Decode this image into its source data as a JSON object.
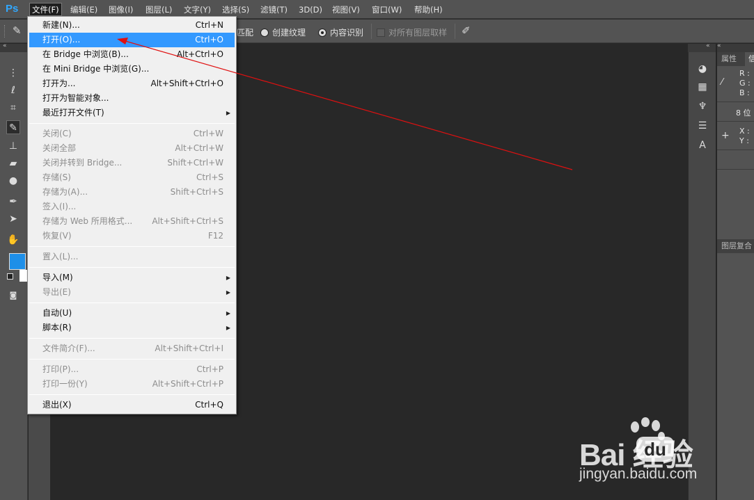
{
  "app": {
    "logo": "Ps"
  },
  "menubar": {
    "items": [
      "文件(F)",
      "编辑(E)",
      "图像(I)",
      "图层(L)",
      "文字(Y)",
      "选择(S)",
      "滤镜(T)",
      "3D(D)",
      "视图(V)",
      "窗口(W)",
      "帮助(H)"
    ]
  },
  "options_bar": {
    "partial_label": "匹配",
    "radio_create_texture": "创建纹理",
    "radio_content_aware": "内容识别",
    "checkbox_sample_all": "对所有图层取样"
  },
  "right_panel": {
    "tab_properties": "属性",
    "tab_info_partial": "信",
    "r_label": "R :",
    "g_label": "G :",
    "b_label": "B :",
    "bit_label": "8 位",
    "x_label": "X :",
    "y_label": "Y :",
    "lower_tab": "图层复合"
  },
  "file_menu": {
    "groups": [
      [
        {
          "label": "新建(N)...",
          "shortcut": "Ctrl+N",
          "enabled": true
        },
        {
          "label": "打开(O)...",
          "shortcut": "Ctrl+O",
          "enabled": true,
          "highlighted": true
        },
        {
          "label": "在 Bridge 中浏览(B)...",
          "shortcut": "Alt+Ctrl+O",
          "enabled": true
        },
        {
          "label": "在 Mini Bridge 中浏览(G)...",
          "shortcut": "",
          "enabled": true
        },
        {
          "label": "打开为...",
          "shortcut": "Alt+Shift+Ctrl+O",
          "enabled": true
        },
        {
          "label": "打开为智能对象...",
          "shortcut": "",
          "enabled": true
        },
        {
          "label": "最近打开文件(T)",
          "shortcut": "",
          "enabled": true,
          "submenu": true
        }
      ],
      [
        {
          "label": "关闭(C)",
          "shortcut": "Ctrl+W",
          "enabled": false
        },
        {
          "label": "关闭全部",
          "shortcut": "Alt+Ctrl+W",
          "enabled": false
        },
        {
          "label": "关闭并转到 Bridge...",
          "shortcut": "Shift+Ctrl+W",
          "enabled": false
        },
        {
          "label": "存储(S)",
          "shortcut": "Ctrl+S",
          "enabled": false
        },
        {
          "label": "存储为(A)...",
          "shortcut": "Shift+Ctrl+S",
          "enabled": false
        },
        {
          "label": "签入(I)...",
          "shortcut": "",
          "enabled": false
        },
        {
          "label": "存储为 Web 所用格式...",
          "shortcut": "Alt+Shift+Ctrl+S",
          "enabled": false
        },
        {
          "label": "恢复(V)",
          "shortcut": "F12",
          "enabled": false
        }
      ],
      [
        {
          "label": "置入(L)...",
          "shortcut": "",
          "enabled": false
        }
      ],
      [
        {
          "label": "导入(M)",
          "shortcut": "",
          "enabled": true,
          "submenu": true
        },
        {
          "label": "导出(E)",
          "shortcut": "",
          "enabled": false,
          "submenu": true
        }
      ],
      [
        {
          "label": "自动(U)",
          "shortcut": "",
          "enabled": true,
          "submenu": true
        },
        {
          "label": "脚本(R)",
          "shortcut": "",
          "enabled": true,
          "submenu": true
        }
      ],
      [
        {
          "label": "文件简介(F)...",
          "shortcut": "Alt+Shift+Ctrl+I",
          "enabled": false
        }
      ],
      [
        {
          "label": "打印(P)...",
          "shortcut": "Ctrl+P",
          "enabled": false
        },
        {
          "label": "打印一份(Y)",
          "shortcut": "Alt+Shift+Ctrl+P",
          "enabled": false
        }
      ],
      [
        {
          "label": "退出(X)",
          "shortcut": "Ctrl+Q",
          "enabled": true
        }
      ]
    ]
  },
  "colors": {
    "foreground": "#1e8fe8",
    "background": "#ffffff",
    "highlight": "#3399ff",
    "annotation_arrow": "#e01010"
  },
  "watermark": {
    "brand": "Bai  经验",
    "brand_du": "du",
    "url": "jingyan.baidu.com"
  }
}
